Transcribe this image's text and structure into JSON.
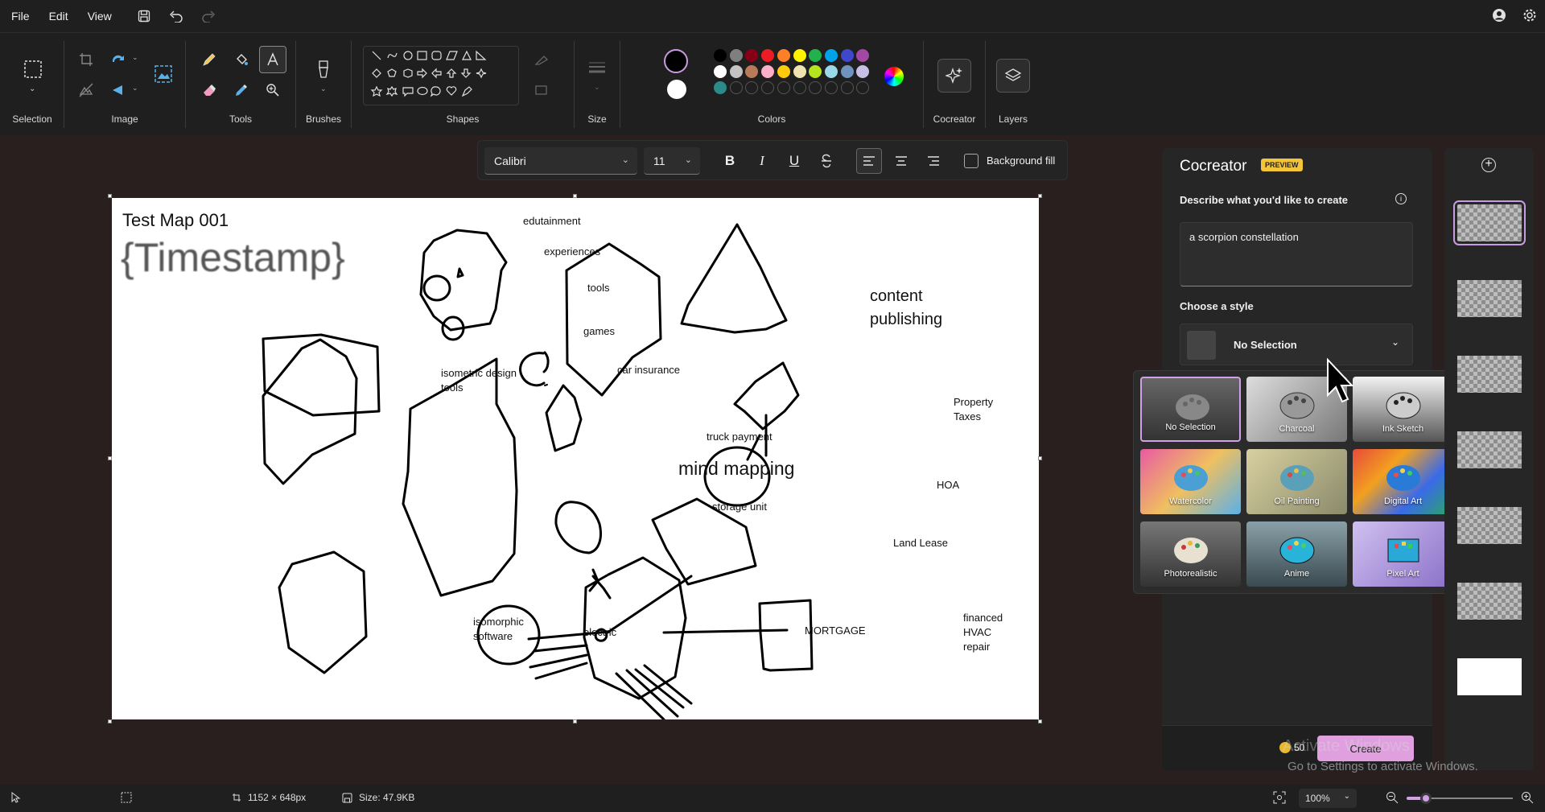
{
  "menu": {
    "file": "File",
    "edit": "Edit",
    "view": "View"
  },
  "ribbon": {
    "groups": {
      "selection": "Selection",
      "image": "Image",
      "tools": "Tools",
      "brushes": "Brushes",
      "shapes": "Shapes",
      "size": "Size",
      "colors": "Colors",
      "cocreator": "Cocreator",
      "layers": "Layers"
    },
    "palette_row1": [
      "#000000",
      "#7f7f7f",
      "#880015",
      "#ed1c24",
      "#ff7f27",
      "#fff200",
      "#22b14c",
      "#00a2e8",
      "#3f48cc",
      "#a349a4"
    ],
    "palette_row2": [
      "#ffffff",
      "#c3c3c3",
      "#b97a57",
      "#ffaec9",
      "#ffc90e",
      "#efe4b0",
      "#b5e61d",
      "#99d9ea",
      "#7092be",
      "#c8bfe7"
    ],
    "palette_row3_first": "#2b8a8a",
    "primary_color": "#000000",
    "secondary_color": "#ffffff"
  },
  "textbar": {
    "font": "Calibri",
    "size": "11",
    "background_fill": "Background fill"
  },
  "canvas": {
    "title": "Test Map 001",
    "timestamp": "{Timestamp}",
    "labels": {
      "edutainment": "edutainment",
      "experiences": "experiences",
      "tools": "tools",
      "games": "games",
      "car_insurance": "car insurance",
      "isometric_1": "isometric design",
      "isometric_2": "tools",
      "content_1": "content",
      "content_2": "publishing",
      "property_1": "Property",
      "property_2": "Taxes",
      "truck": "truck payment",
      "mind": "mind mapping",
      "hoa": "HOA",
      "storage": "storage unit",
      "land": "Land Lease",
      "isomorphic_1": "isomorphic",
      "isomorphic_2": "software",
      "electric": "electric",
      "mortgage": "MORTGAGE",
      "financed_1": "financed",
      "financed_2": "HVAC",
      "financed_3": "repair"
    }
  },
  "cocreator": {
    "title": "Cocreator",
    "badge": "PREVIEW",
    "describe_label": "Describe what you'd like to create",
    "prompt": "a scorpion constellation",
    "style_label": "Choose a style",
    "selected_style": "No Selection",
    "styles": [
      "No Selection",
      "Charcoal",
      "Ink Sketch",
      "Watercolor",
      "Oil Painting",
      "Digital Art",
      "Photorealistic",
      "Anime",
      "Pixel Art"
    ],
    "credits": "50",
    "create": "Create"
  },
  "watermark": {
    "title": "Activate Windows",
    "text": "Go to Settings to activate Windows."
  },
  "status": {
    "dimensions": "1152 × 648px",
    "size": "Size: 47.9KB",
    "zoom": "100%"
  }
}
